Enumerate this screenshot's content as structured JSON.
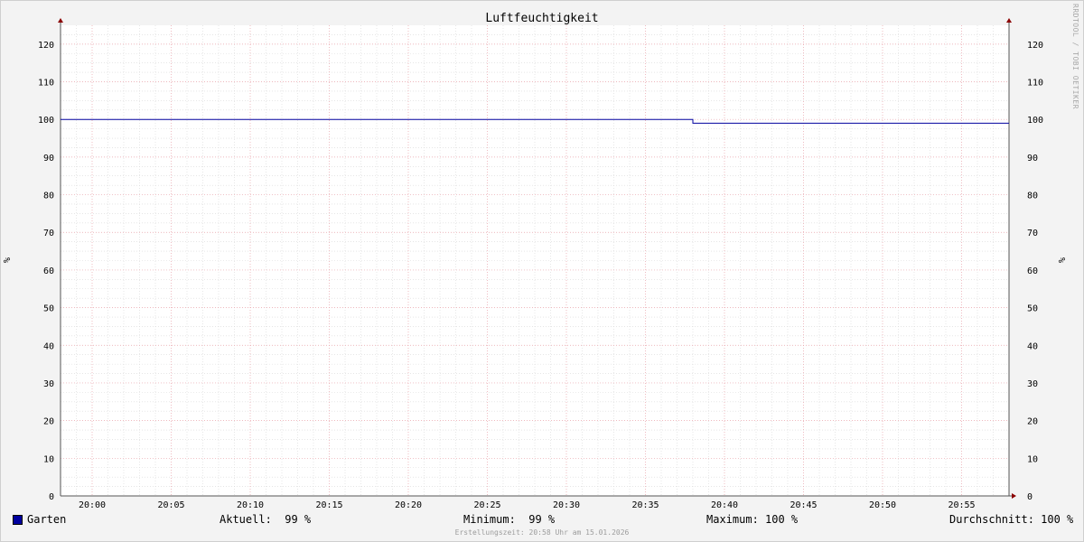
{
  "chart_data": {
    "type": "line",
    "title": "Luftfeuchtigkeit",
    "ylabel": "%",
    "ylim": [
      0,
      125
    ],
    "y_ticks": [
      0,
      10,
      20,
      30,
      40,
      50,
      60,
      70,
      80,
      90,
      100,
      110,
      120
    ],
    "x_ticks": [
      "20:00",
      "20:05",
      "20:10",
      "20:15",
      "20:20",
      "20:25",
      "20:30",
      "20:35",
      "20:40",
      "20:45",
      "20:50",
      "20:55"
    ],
    "xlim": [
      "19:58",
      "20:58"
    ],
    "grid": true,
    "series": [
      {
        "name": "Garten",
        "color": "#00009f",
        "x": [
          "19:58",
          "20:38",
          "20:38",
          "20:58"
        ],
        "values": [
          100,
          100,
          99,
          99
        ]
      }
    ]
  },
  "legend": {
    "series_name": "Garten",
    "current": "Aktuell:  99 %",
    "minimum": "Minimum:  99 %",
    "maximum": "Maximum: 100 %",
    "average": "Durchschnitt: 100 %"
  },
  "footer": "Erstellungszeit: 20:58 Uhr am 15.01.2026",
  "watermark": "RRDTOOL / TOBI OETIKER"
}
